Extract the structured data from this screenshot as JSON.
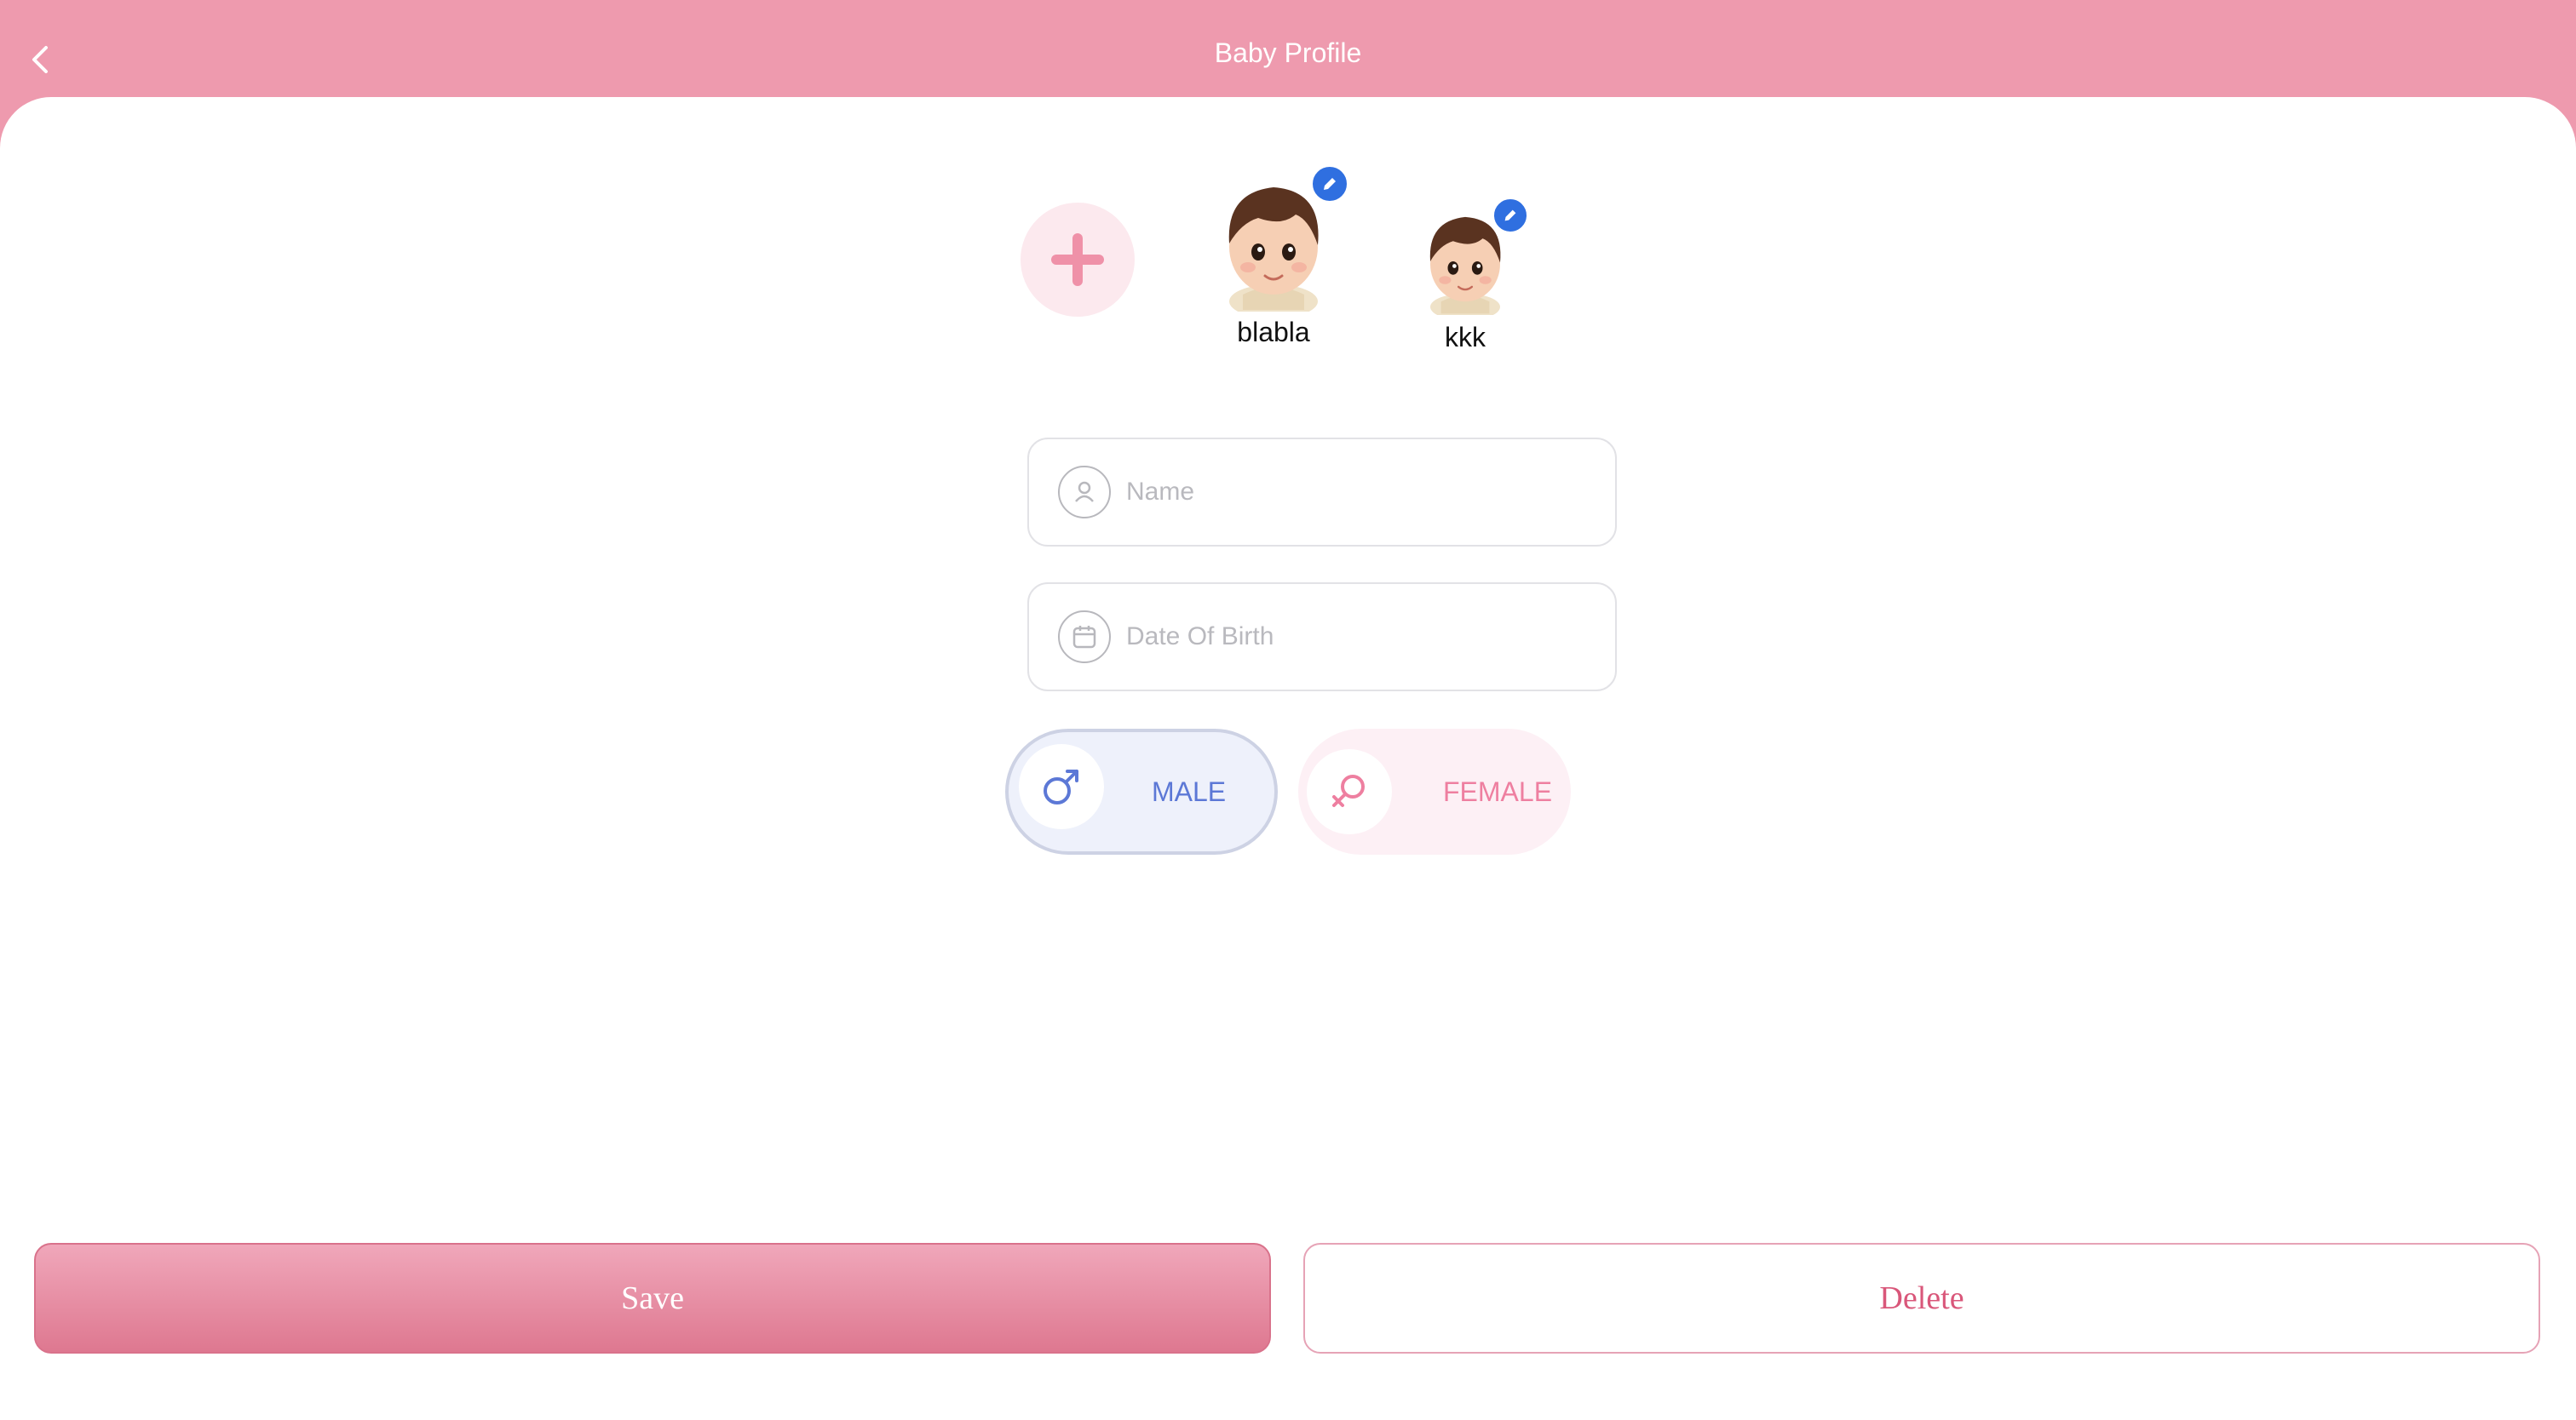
{
  "header": {
    "title": "Baby Profile"
  },
  "babies": [
    {
      "name": "blabla",
      "selected": true
    },
    {
      "name": "kkk",
      "selected": false
    }
  ],
  "form": {
    "name_placeholder": "Name",
    "name_value": "",
    "dob_placeholder": "Date Of Birth",
    "dob_value": ""
  },
  "gender": {
    "male_label": "MALE",
    "female_label": "FEMALE",
    "selected": "MALE"
  },
  "actions": {
    "save_label": "Save",
    "delete_label": "Delete"
  },
  "icons": {
    "back": "chevron-left-icon",
    "add": "plus-icon",
    "edit": "pencil-icon",
    "name": "user-icon",
    "dob": "calendar-icon",
    "male": "male-symbol-icon",
    "female": "female-symbol-icon"
  },
  "colors": {
    "header": "#ee9aae",
    "accent_pink": "#de7890",
    "male_blue": "#5c78d6",
    "female_pink": "#ee7fa0",
    "edit_badge": "#2f6fe0"
  }
}
